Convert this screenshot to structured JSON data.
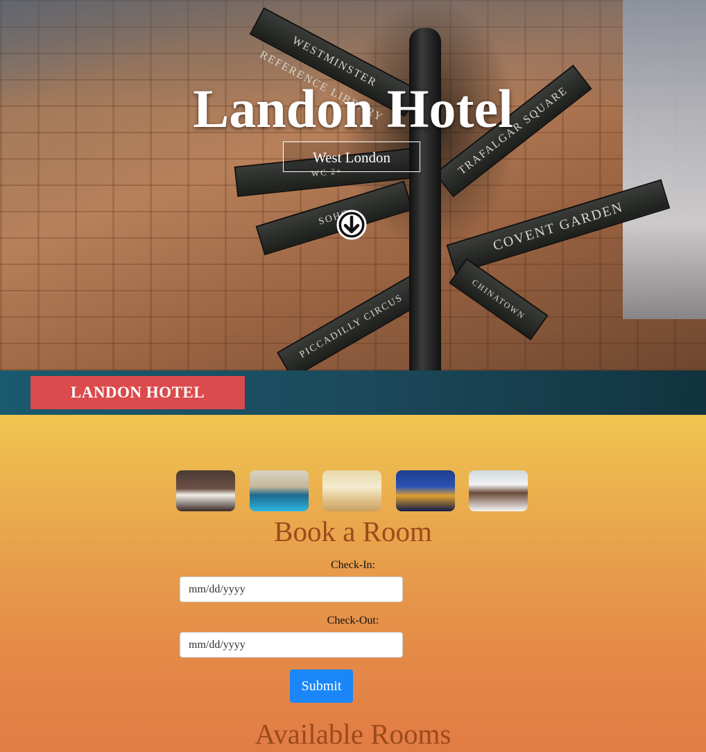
{
  "hero": {
    "title": "Landon Hotel",
    "subtitle": "West London",
    "signs": [
      "WESTMINSTER REFERENCE LIBRARY",
      "TRAFALGAR SQUARE",
      "COVENT GARDEN",
      "PICCADILLY CIRCUS",
      "SOHO",
      "CHINATOWN",
      "WC 2+"
    ],
    "scroll_icon": "arrow-down-circle-icon"
  },
  "navbar": {
    "brand": "LANDON HOTEL",
    "brand_color": "#db4a4c",
    "background": "#1a5a6e"
  },
  "gallery": {
    "images": [
      "hotel-bedroom-image",
      "indoor-pool-image",
      "dining-room-image",
      "london-parliament-night-image",
      "wedding-couple-image"
    ]
  },
  "booking": {
    "title": "Book a Room",
    "checkin_label": "Check-In:",
    "checkin_placeholder": "mm/dd/yyyy",
    "checkout_label": "Check-Out:",
    "checkout_placeholder": "mm/dd/yyyy",
    "submit_label": "Submit",
    "submit_color": "#1a86f7"
  },
  "rooms": {
    "title": "Available Rooms"
  }
}
